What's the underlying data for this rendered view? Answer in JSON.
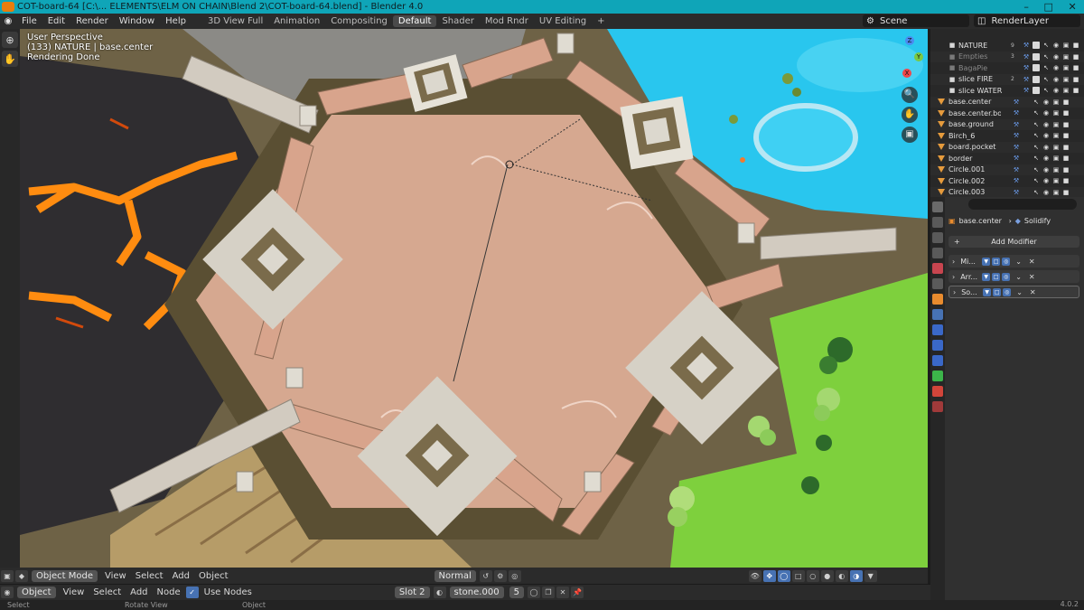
{
  "window": {
    "title": "COT-board-64 [C:\\... ELEMENTS\\ELM ON CHAIN\\Blend 2\\COT-board-64.blend] - Blender 4.0"
  },
  "menu": [
    "File",
    "Edit",
    "Render",
    "Window",
    "Help"
  ],
  "workspaces": [
    {
      "label": "3D View Full",
      "active": false
    },
    {
      "label": "Animation",
      "active": false
    },
    {
      "label": "Compositing",
      "active": false
    },
    {
      "label": "Default",
      "active": true
    },
    {
      "label": "Shader",
      "active": false
    },
    {
      "label": "Mod Rndr",
      "active": false
    },
    {
      "label": "UV Editing",
      "active": false
    }
  ],
  "scene": {
    "name": "Scene",
    "view_layer": "RenderLayer"
  },
  "viewport": {
    "overlay": [
      "User Perspective",
      "(133) NATURE | base.center",
      "Rendering Done"
    ],
    "gizmo": {
      "x": "X",
      "y": "Y",
      "z": "Z"
    }
  },
  "viewport_header": {
    "mode": "Object Mode",
    "menus": [
      "View",
      "Select",
      "Add",
      "Object"
    ],
    "orientation": "Normal"
  },
  "node_header": {
    "editor": "Object",
    "menus": [
      "View",
      "Select",
      "Add",
      "Node"
    ],
    "use_nodes_label": "Use Nodes",
    "slot": "Slot 2",
    "material": "stone.000",
    "users": "5"
  },
  "statusbar": {
    "left": "Select",
    "middle": "Rotate View",
    "right": "Object",
    "version": "4.0.2"
  },
  "outliner": {
    "rows": [
      {
        "name": "NATURE",
        "kind": "collection",
        "count": "9",
        "dim": false
      },
      {
        "name": "Empties",
        "kind": "collection",
        "count": "3",
        "dim": true
      },
      {
        "name": "BagaPie",
        "kind": "collection",
        "count": "",
        "dim": true
      },
      {
        "name": "slice FIRE",
        "kind": "collection",
        "count": "2",
        "dim": false
      },
      {
        "name": "slice WATER",
        "kind": "collection",
        "count": "",
        "dim": false
      },
      {
        "name": "base.center",
        "kind": "object",
        "count": "",
        "dim": false
      },
      {
        "name": "base.center.border",
        "kind": "object",
        "count": "",
        "dim": false
      },
      {
        "name": "base.ground",
        "kind": "object",
        "count": "",
        "dim": false
      },
      {
        "name": "Birch_6",
        "kind": "object",
        "count": "",
        "dim": false
      },
      {
        "name": "board.pocket",
        "kind": "object",
        "count": "",
        "dim": false
      },
      {
        "name": "border",
        "kind": "object",
        "count": "",
        "dim": false
      },
      {
        "name": "Circle.001",
        "kind": "object",
        "count": "",
        "dim": false
      },
      {
        "name": "Circle.002",
        "kind": "object",
        "count": "",
        "dim": false
      },
      {
        "name": "Circle.003",
        "kind": "object",
        "count": "",
        "dim": false
      }
    ]
  },
  "properties": {
    "object": "base.center",
    "modifier_context": "Solidify",
    "add_modifier": "Add Modifier",
    "modifiers": [
      "Mi...",
      "Arr...",
      "So..."
    ]
  },
  "colors": {
    "titlebar": "#0fa5b8",
    "accent_blue": "#4772b3",
    "outliner_orange": "#e69b3c",
    "lava": "#ff8c10",
    "water": "#27c3ee",
    "grass": "#7dcf3c"
  }
}
